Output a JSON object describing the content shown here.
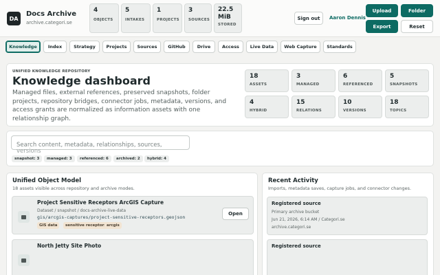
{
  "brand": {
    "logo": "DA",
    "title": "Docs Archive",
    "subtitle": "archive.categori.se"
  },
  "header_stats": [
    {
      "value": "4",
      "label": "OBJECTS"
    },
    {
      "value": "5",
      "label": "INTAKES"
    },
    {
      "value": "1",
      "label": "PROJECTS"
    },
    {
      "value": "3",
      "label": "SOURCES"
    },
    {
      "value": "22.5 MiB",
      "label": "STORED"
    }
  ],
  "header_actions": {
    "sign_out": "Sign out",
    "user": "Aaron Dennis",
    "upload": "Upload",
    "folder": "Folder",
    "export": "Export",
    "reset": "Reset"
  },
  "tabs": [
    "Knowledge",
    "Index",
    "Strategy",
    "Projects",
    "Sources",
    "GitHub",
    "Drive",
    "Access",
    "Live Data",
    "Web Capture",
    "Standards"
  ],
  "active_tab": "Knowledge",
  "hero": {
    "kicker": "UNIFIED KNOWLEDGE REPOSITORY",
    "title": "Knowledge dashboard",
    "description": "Managed files, external references, preserved snapshots, folder projects, repository bridges, connector jobs, metadata, versions, and access grants are normalized as information assets with one relationship graph.",
    "metrics": [
      {
        "value": "18",
        "label": "ASSETS"
      },
      {
        "value": "3",
        "label": "MANAGED"
      },
      {
        "value": "6",
        "label": "REFERENCED"
      },
      {
        "value": "5",
        "label": "SNAPSHOTS"
      },
      {
        "value": "4",
        "label": "HYBRID"
      },
      {
        "value": "15",
        "label": "RELATIONS"
      },
      {
        "value": "10",
        "label": "VERSIONS"
      },
      {
        "value": "18",
        "label": "TOPICS"
      }
    ]
  },
  "search": {
    "placeholder": "Search content, metadata, relationships, sources,",
    "placeholder_overflow": "versions",
    "chips": [
      "snapshot: 3",
      "managed: 3",
      "referenced: 6",
      "archived: 2",
      "hybrid: 4"
    ]
  },
  "object_model": {
    "title": "Unified Object Model",
    "subtitle": "18 assets visible across repository and archive modes.",
    "items": [
      {
        "title": "Project Sensitive Receptors ArcGIS Capture",
        "meta": "Dataset / snapshot / docs-archive-live-data",
        "path": "gis/arcgis-captures/project-sensitive-receptors.geojson",
        "tags": [
          "GIS data",
          "sensitive receptors",
          "arcgis"
        ],
        "action": "Open",
        "icon": "dataset-icon"
      },
      {
        "title": "North Jetty Site Photo",
        "icon": "photo-icon"
      }
    ]
  },
  "activity": {
    "title": "Recent Activity",
    "subtitle": "Imports, metadata saves, capture jobs, and connector changes.",
    "items": [
      {
        "title": "Registered source",
        "detail": "Primary archive bucket",
        "time": "Jun 21, 2026, 6:14 AM / Categori.se",
        "host": "archive.categori.se"
      },
      {
        "title": "Registered source"
      }
    ]
  }
}
